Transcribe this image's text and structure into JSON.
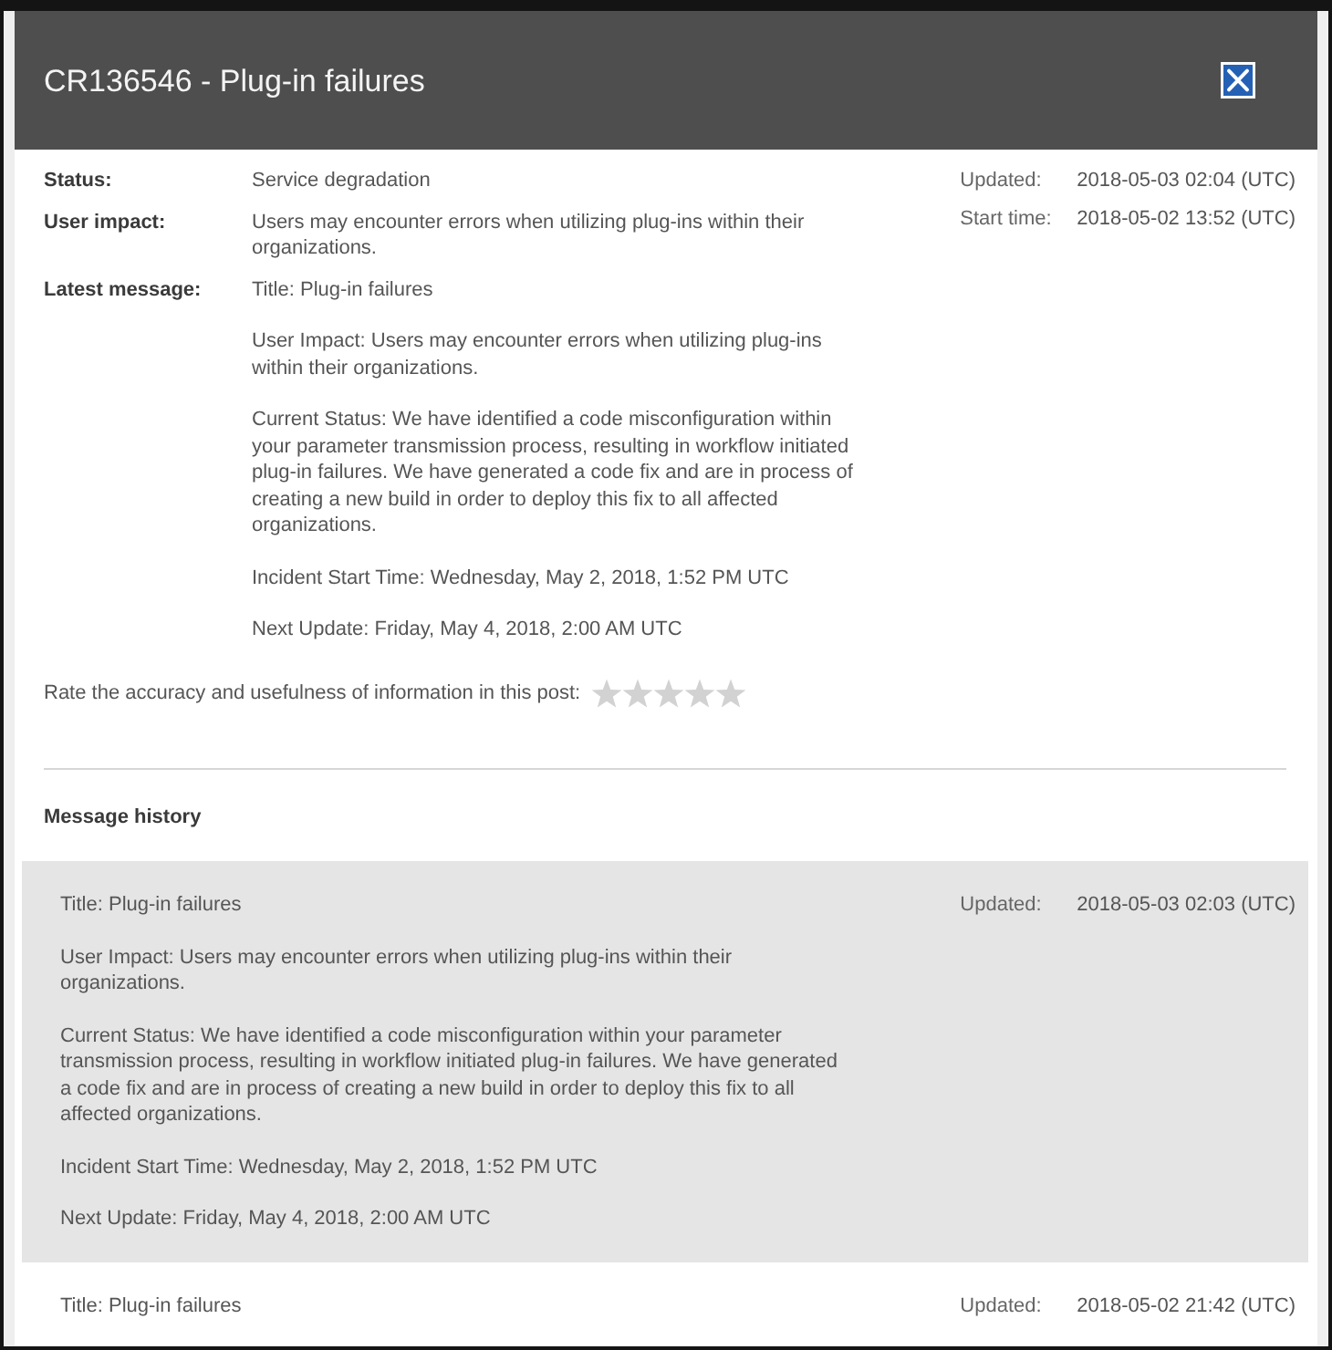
{
  "dialog": {
    "title": "CR136546 - Plug-in failures"
  },
  "details": [
    {
      "label": "Status:",
      "value": "Service degradation"
    },
    {
      "label": "User impact:",
      "value": "Users may encounter errors when utilizing plug-ins within their organizations."
    }
  ],
  "latest_message": {
    "label": "Latest message:",
    "paragraphs": [
      "Title: Plug-in failures",
      "User Impact: Users may encounter errors when utilizing plug-ins within their organizations.",
      "Current Status: We have identified a code misconfiguration within your parameter transmission process, resulting in workflow initiated plug-in failures. We have generated a code fix and are in process of creating a new build in order to deploy this fix to all affected organizations.",
      "Incident Start Time: Wednesday, May 2, 2018, 1:52 PM UTC",
      "Next Update: Friday, May 4, 2018, 2:00 AM UTC"
    ]
  },
  "timestamps": [
    {
      "label": "Updated:",
      "value": "2018-05-03 02:04 (UTC)"
    },
    {
      "label": "Start time:",
      "value": "2018-05-02 13:52 (UTC)"
    }
  ],
  "rating": {
    "prompt": "Rate the accuracy and usefulness of information in this post:",
    "stars": 0
  },
  "message_history": {
    "heading": "Message history",
    "entries": [
      {
        "highlighted": true,
        "paragraphs": [
          "Title: Plug-in failures",
          "User Impact: Users may encounter errors when utilizing plug-ins within their organizations.",
          "Current Status: We have identified a code misconfiguration within your parameter transmission process, resulting in workflow initiated plug-in failures. We have generated a code fix and are in process of creating a new build in order to deploy this fix to all affected organizations.",
          "Incident Start Time: Wednesday, May 2, 2018, 1:52 PM UTC",
          "Next Update: Friday, May 4, 2018, 2:00 AM UTC"
        ],
        "updated_label": "Updated:",
        "updated": "2018-05-03 02:03 (UTC)"
      },
      {
        "highlighted": false,
        "paragraphs": [
          "Title: Plug-in failures"
        ],
        "updated_label": "Updated:",
        "updated": "2018-05-02 21:42 (UTC)"
      }
    ]
  }
}
